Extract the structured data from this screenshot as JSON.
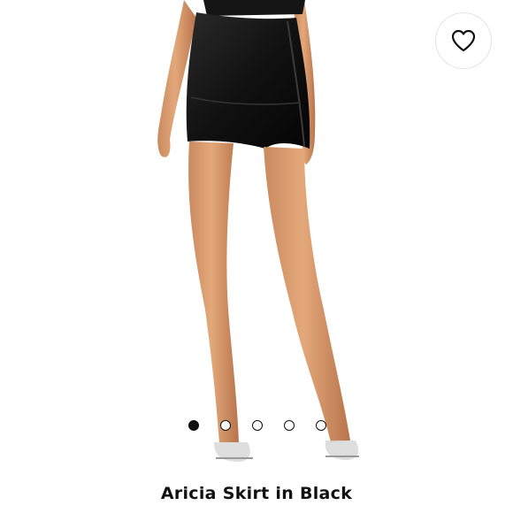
{
  "product": {
    "title": "Aricia Skirt in Black"
  },
  "favorite": {
    "icon": "heart-outline-icon",
    "selected": false
  },
  "carousel": {
    "total": 5,
    "active_index": 0
  },
  "colors": {
    "background": "#ffffff",
    "text": "#111111",
    "dot": "#111111",
    "border": "#e3e3e3"
  }
}
